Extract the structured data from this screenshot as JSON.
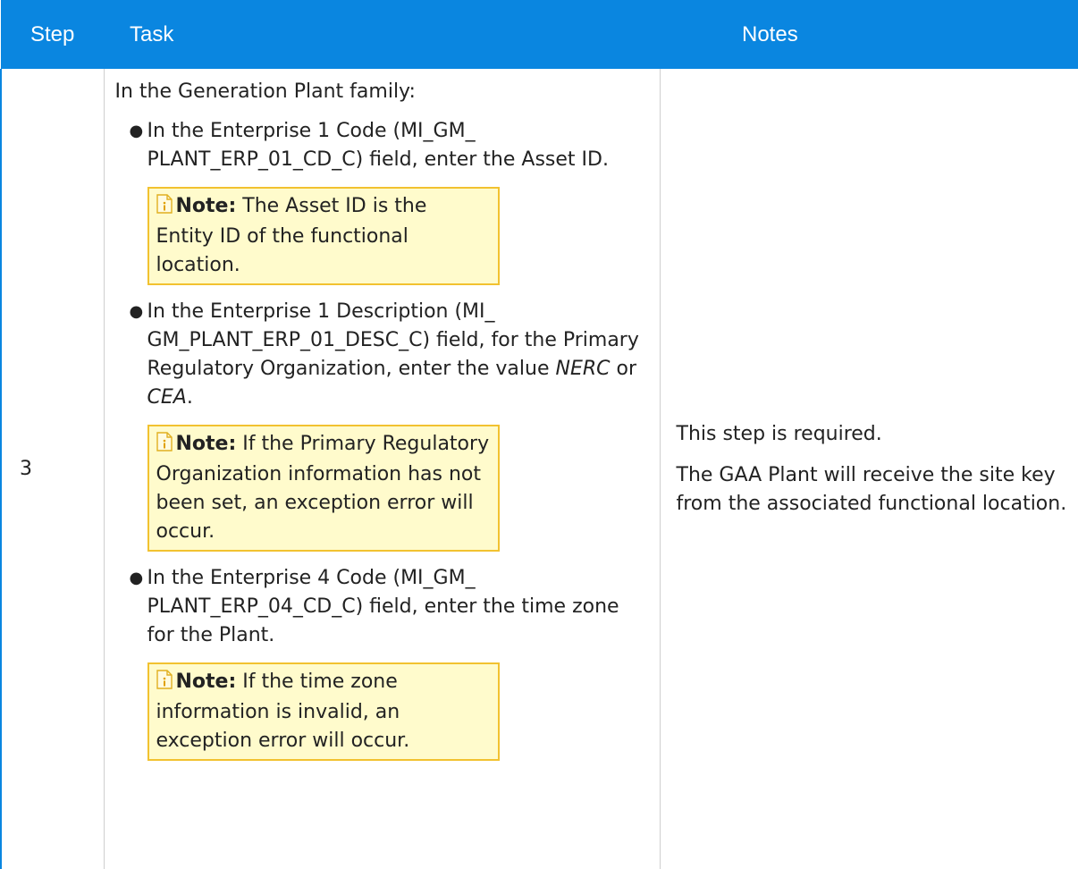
{
  "header": {
    "step_label": "Step",
    "task_label": "Task",
    "notes_label": "Notes"
  },
  "row": {
    "step": "3",
    "intro": "In the Generation Plant family:",
    "items": [
      {
        "text_pre": "In the Enterprise 1 Code (MI_GM_ PLANT_ERP_01_CD_C) field, enter the Asset ID.",
        "emph1": "",
        "mid": "",
        "emph2": "",
        "post": "",
        "note_label": "Note:",
        "note_text": "The Asset ID is the Entity ID of the functional location."
      },
      {
        "text_pre": "In the Enterprise 1 Description (MI_ GM_PLANT_ERP_01_DESC_C) field, for the Primary Regulatory Organization, enter the value ",
        "emph1": "NERC",
        "mid": " or ",
        "emph2": "CEA",
        "post": ".",
        "note_label": "Note:",
        "note_text": "If the Primary Regulatory Organization information has not been set, an exception error will occur."
      },
      {
        "text_pre": "In the Enterprise 4 Code (MI_GM_ PLANT_ERP_04_CD_C) field, enter the time zone for the Plant.",
        "emph1": "",
        "mid": "",
        "emph2": "",
        "post": "",
        "note_label": "Note:",
        "note_text": "If the time zone information is invalid, an exception error will occur."
      }
    ],
    "notes": {
      "line1": "This step is required.",
      "line2": "The GAA Plant will receive the site key from the associated functional location."
    }
  },
  "icons": {
    "note": "note-info-icon",
    "bullet": "bullet-dot"
  },
  "colors": {
    "header_bg": "#0a86e0",
    "note_bg": "#fffbcc",
    "note_border": "#f2c230"
  }
}
